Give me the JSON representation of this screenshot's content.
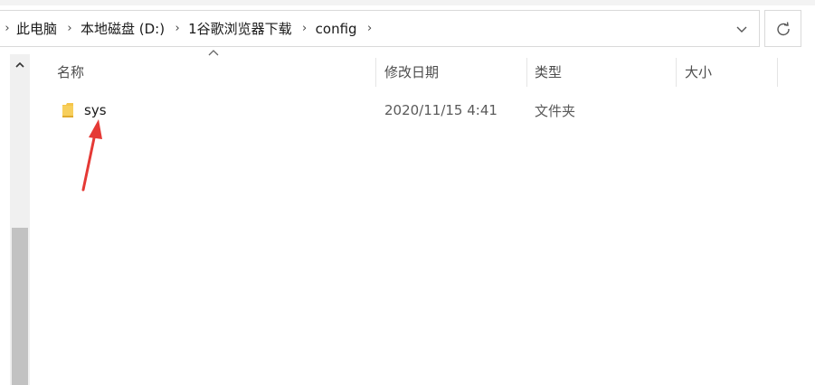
{
  "breadcrumb": {
    "items": [
      "此电脑",
      "本地磁盘 (D:)",
      "1谷歌浏览器下载",
      "config"
    ]
  },
  "address_bar": {
    "dropdown_icon": "chevron-down-icon",
    "refresh_icon": "refresh-icon"
  },
  "columns": {
    "name": "名称",
    "date": "修改日期",
    "type": "类型",
    "size": "大小"
  },
  "files": [
    {
      "name": "sys",
      "date": "2020/11/15 4:41",
      "type": "文件夹",
      "size": "",
      "icon": "folder-icon"
    }
  ],
  "colors": {
    "folder": "#f5c54a",
    "annotation": "#e53935",
    "scroll_thumb": "#c2c2c2"
  }
}
